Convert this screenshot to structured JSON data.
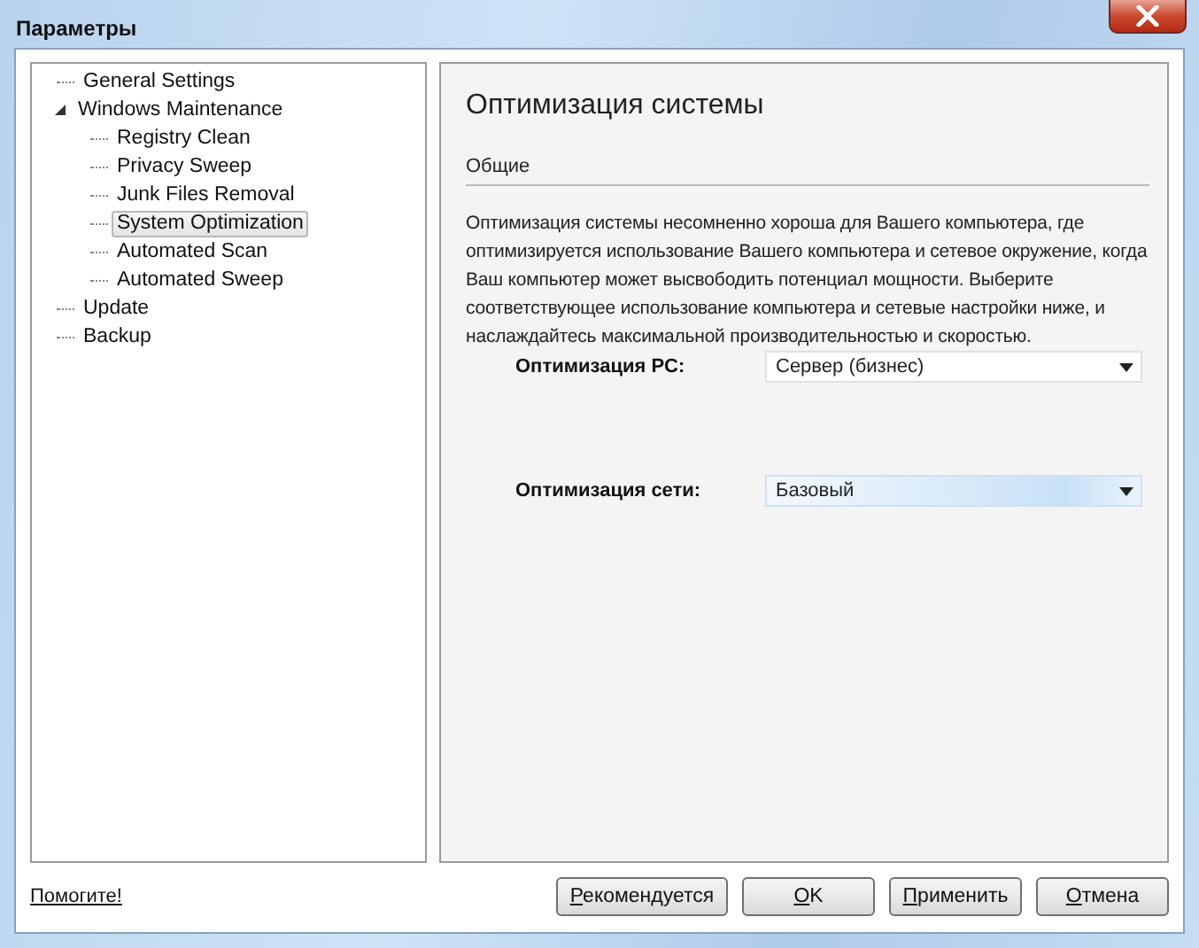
{
  "window": {
    "title": "Параметры"
  },
  "tree": [
    {
      "label": "General Settings",
      "selected": false
    },
    {
      "label": "Windows Maintenance",
      "selected": false,
      "expanded": true,
      "children": [
        {
          "label": "Registry Clean",
          "selected": false
        },
        {
          "label": "Privacy Sweep",
          "selected": false
        },
        {
          "label": "Junk Files Removal",
          "selected": false
        },
        {
          "label": "System Optimization",
          "selected": true
        },
        {
          "label": "Automated Scan",
          "selected": false
        },
        {
          "label": "Automated Sweep",
          "selected": false
        }
      ]
    },
    {
      "label": "Update",
      "selected": false
    },
    {
      "label": "Backup",
      "selected": false
    }
  ],
  "panel": {
    "title": "Оптимизация системы",
    "section": "Общие",
    "description": "Оптимизация системы несомненно хороша для Вашего компьютера, где оптимизируется использование Вашего компьютера и сетевое окружение, когда Ваш компьютер может высвободить потенциал мощности. Выберите соответствующее использование компьютера и сетевые настройки ниже, и наслаждайтесь максимальной производительностью и скоростью.",
    "settings": [
      {
        "label": "Оптимизация PC:",
        "value": "Сервер (бизнес)",
        "focused": false
      },
      {
        "label": "Оптимизация сети:",
        "value": "Базовый",
        "focused": true
      }
    ]
  },
  "help_link": "Помогите!",
  "buttons": [
    "Рекомендуется",
    "OK",
    "Применить",
    "Отмена"
  ]
}
